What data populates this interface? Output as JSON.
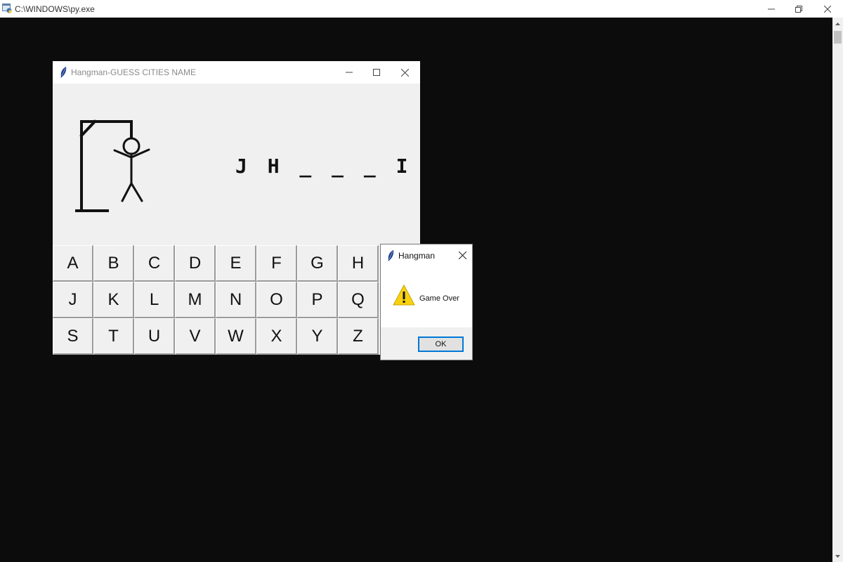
{
  "console": {
    "title": "C:\\WINDOWS\\py.exe",
    "icon": "python-console-icon"
  },
  "hangman": {
    "title": "Hangman-GUESS CITIES NAME",
    "icon": "tk-feather-icon",
    "word_display": "J H _ _ _ I",
    "keys": [
      "A",
      "B",
      "C",
      "D",
      "E",
      "F",
      "G",
      "H",
      "J",
      "K",
      "L",
      "M",
      "N",
      "O",
      "P",
      "Q",
      "S",
      "T",
      "U",
      "V",
      "W",
      "X",
      "Y",
      "Z"
    ]
  },
  "dialog": {
    "title": "Hangman",
    "message": "Game Over",
    "ok_label": "OK",
    "icon": "warning-icon"
  },
  "colors": {
    "console_bg": "#0c0c0c",
    "window_bg": "#f0f0f0",
    "ok_focus": "#0078d7",
    "warning": "#f8d210"
  }
}
